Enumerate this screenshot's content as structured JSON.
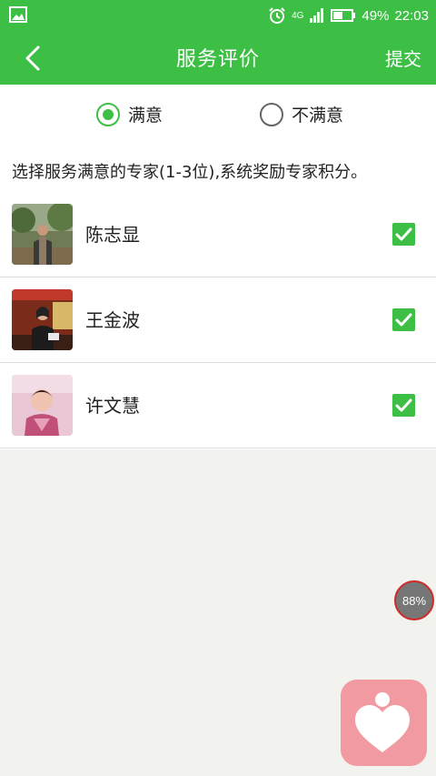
{
  "status_bar": {
    "network": "4G",
    "battery": "49%",
    "time": "22:03"
  },
  "nav": {
    "title": "服务评价",
    "submit_label": "提交"
  },
  "rating": {
    "options": [
      "满意",
      "不满意"
    ],
    "selected": "满意"
  },
  "instruction": "选择服务满意的专家(1-3位),系统奖励专家积分。",
  "experts": [
    {
      "name": "陈志显",
      "checked": true
    },
    {
      "name": "王金波",
      "checked": true
    },
    {
      "name": "许文慧",
      "checked": true
    }
  ],
  "floating_badge": "88%",
  "colors": {
    "primary": "#3cbf44",
    "fab": "#f29aa1"
  },
  "icons": {
    "back": "chevron-left-icon",
    "check": "checkmark-icon",
    "fab": "heart-person-icon"
  }
}
